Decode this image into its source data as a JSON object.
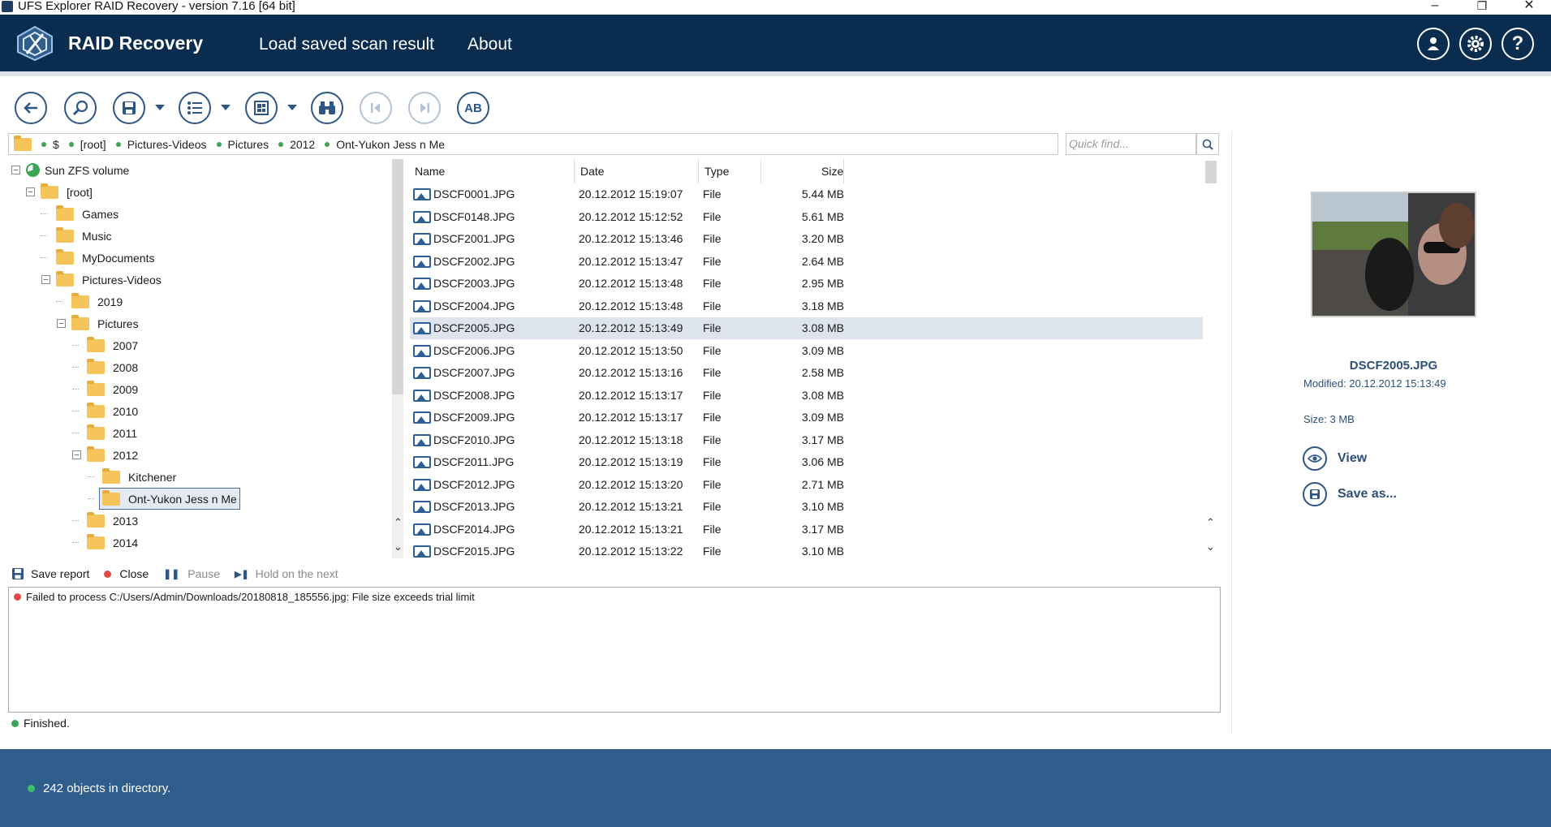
{
  "window": {
    "title": "UFS Explorer RAID Recovery - version 7.16 [64 bit]",
    "controls": [
      "minimize-icon",
      "restore-icon",
      "close-icon"
    ]
  },
  "header": {
    "app_name": "RAID Recovery",
    "nav": [
      "Load saved scan result",
      "About"
    ],
    "icons": [
      "user-icon",
      "gear-icon",
      "help-icon"
    ]
  },
  "toolbar": {
    "buttons": [
      "back",
      "search",
      "save",
      "view-mode",
      "layout",
      "find",
      "prev",
      "next",
      "case"
    ],
    "case_label": "AB"
  },
  "breadcrumb": {
    "items": [
      "$",
      "[root]",
      "Pictures-Videos",
      "Pictures",
      "2012",
      "Ont-Yukon Jess n Me"
    ]
  },
  "quick_find": {
    "placeholder": "Quick find..."
  },
  "tree": {
    "volume": "Sun ZFS volume",
    "root": "[root]",
    "games": "Games",
    "music": "Music",
    "mydocuments": "MyDocuments",
    "pictures_videos": "Pictures-Videos",
    "y2019": "2019",
    "pictures": "Pictures",
    "y2007": "2007",
    "y2008": "2008",
    "y2009": "2009",
    "y2010": "2010",
    "y2011": "2011",
    "y2012": "2012",
    "kitchener": "Kitchener",
    "ont_yukon": "Ont-Yukon Jess n Me",
    "y2013": "2013",
    "y2014": "2014"
  },
  "list": {
    "columns": [
      "Name",
      "Date",
      "Type",
      "Size"
    ],
    "rows": [
      [
        "DSCF0001.JPG",
        "20.12.2012 15:19:07",
        "File",
        "5.44 MB"
      ],
      [
        "DSCF0148.JPG",
        "20.12.2012 15:12:52",
        "File",
        "5.61 MB"
      ],
      [
        "DSCF2001.JPG",
        "20.12.2012 15:13:46",
        "File",
        "3.20 MB"
      ],
      [
        "DSCF2002.JPG",
        "20.12.2012 15:13:47",
        "File",
        "2.64 MB"
      ],
      [
        "DSCF2003.JPG",
        "20.12.2012 15:13:48",
        "File",
        "2.95 MB"
      ],
      [
        "DSCF2004.JPG",
        "20.12.2012 15:13:48",
        "File",
        "3.18 MB"
      ],
      [
        "DSCF2005.JPG",
        "20.12.2012 15:13:49",
        "File",
        "3.08 MB"
      ],
      [
        "DSCF2006.JPG",
        "20.12.2012 15:13:50",
        "File",
        "3.09 MB"
      ],
      [
        "DSCF2007.JPG",
        "20.12.2012 15:13:16",
        "File",
        "2.58 MB"
      ],
      [
        "DSCF2008.JPG",
        "20.12.2012 15:13:17",
        "File",
        "3.08 MB"
      ],
      [
        "DSCF2009.JPG",
        "20.12.2012 15:13:17",
        "File",
        "3.09 MB"
      ],
      [
        "DSCF2010.JPG",
        "20.12.2012 15:13:18",
        "File",
        "3.17 MB"
      ],
      [
        "DSCF2011.JPG",
        "20.12.2012 15:13:19",
        "File",
        "3.06 MB"
      ],
      [
        "DSCF2012.JPG",
        "20.12.2012 15:13:20",
        "File",
        "2.71 MB"
      ],
      [
        "DSCF2013.JPG",
        "20.12.2012 15:13:21",
        "File",
        "3.10 MB"
      ],
      [
        "DSCF2014.JPG",
        "20.12.2012 15:13:21",
        "File",
        "3.17 MB"
      ],
      [
        "DSCF2015.JPG",
        "20.12.2012 15:13:22",
        "File",
        "3.10 MB"
      ]
    ],
    "selected_index": 6
  },
  "preview": {
    "filename": "DSCF2005.JPG",
    "modified": "Modified: 20.12.2012 15:13:49",
    "size": "Size: 3 MB",
    "view_label": "View",
    "save_label": "Save as..."
  },
  "log": {
    "save_report": "Save report",
    "close": "Close",
    "pause": "Pause",
    "hold": "Hold on the next",
    "message": "Failed to process C:/Users/Admin/Downloads/20180818_185556.jpg: File size exceeds trial limit"
  },
  "status": {
    "text": "Finished."
  },
  "footer": {
    "text": "242 objects in directory."
  },
  "colors": {
    "header_bg": "#092c4f",
    "footer_bg": "#2f5d8c",
    "accent": "#2d5686",
    "selection": "#dde4ee",
    "ok_dot": "#3aa655",
    "error_dot": "#e04848"
  }
}
